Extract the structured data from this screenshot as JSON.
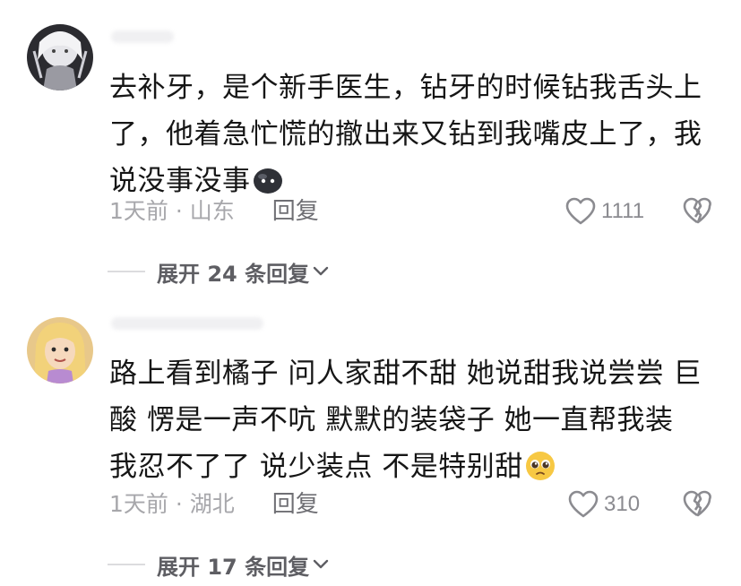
{
  "comments": [
    {
      "avatar_icon": "anime-character-avatar-icon",
      "username": "",
      "text": "去补牙，是个新手医生，钻牙的时候钻我舌头上了，他着急忙慌的撤出来又钻到我嘴皮上了，我说没事没事",
      "emoji": "black-blob-face-emoji",
      "time_location": "1天前 · 山东",
      "reply_label": "回复",
      "like_count": "1111",
      "expand_label": "展开 24 条回复"
    },
    {
      "avatar_icon": "cartoon-girl-avatar-icon",
      "username": "",
      "text": "路上看到橘子 问人家甜不甜 她说甜我说尝尝 巨酸 愣是一声不吭 默默的装袋子 她一直帮我装 我忍不了了 说少装点 不是特别甜",
      "emoji": "pleading-face-emoji",
      "time_location": "1天前 · 湖北",
      "reply_label": "回复",
      "like_count": "310",
      "expand_label": "展开 17 条回复"
    }
  ],
  "colors": {
    "text": "#161616",
    "meta": "#a7a7ab",
    "reply": "#6f6f74",
    "expand": "#5e5e63",
    "divider": "#dcdcde"
  }
}
